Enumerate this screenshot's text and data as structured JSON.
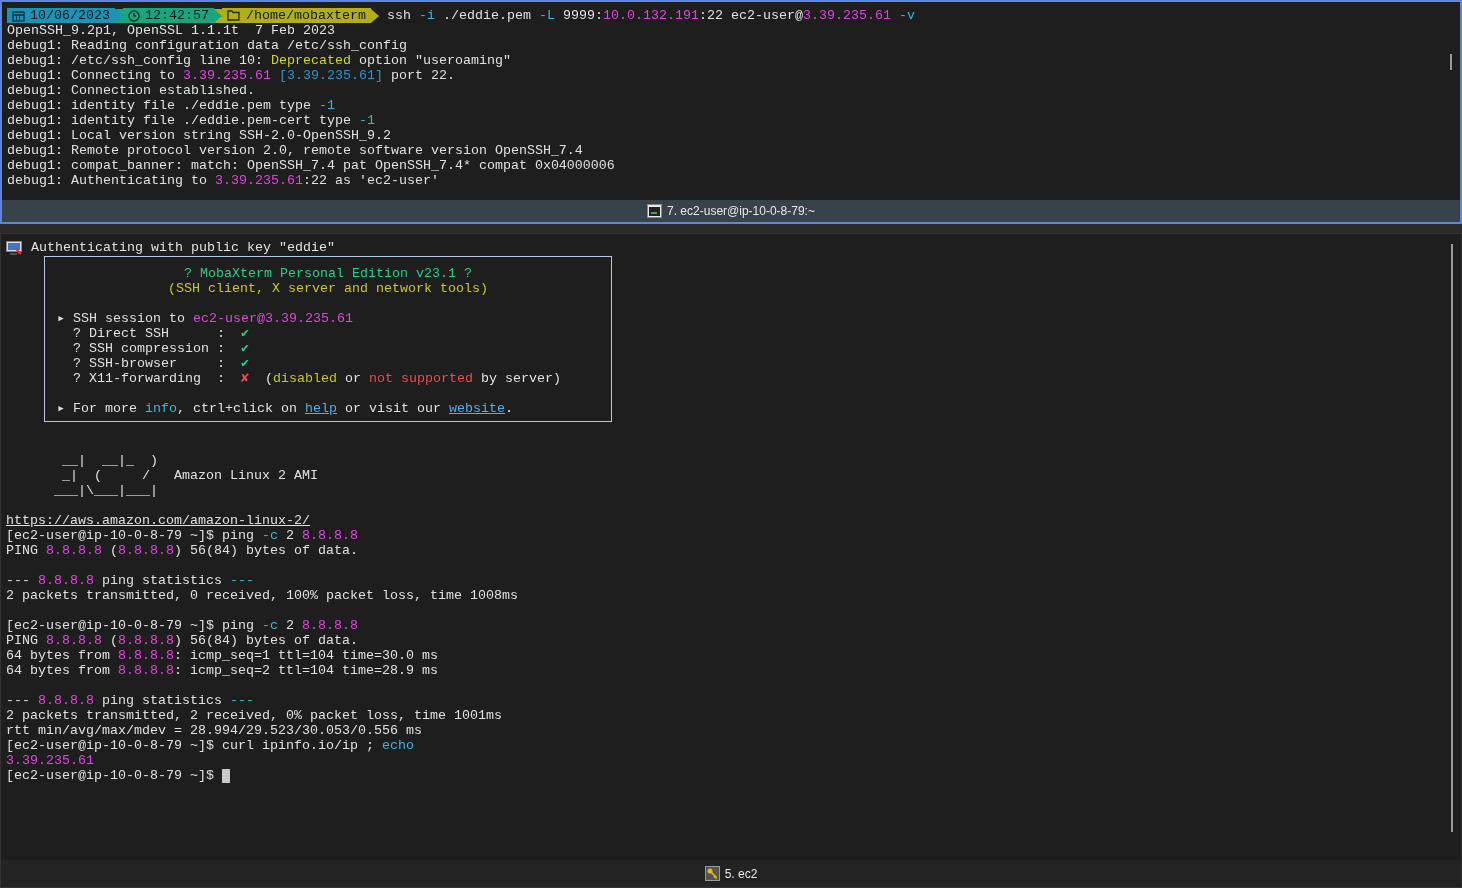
{
  "panes": [
    {
      "active": true,
      "title": "7. ec2-user@ip-10-0-8-79:~",
      "kind": "shell",
      "prompt": [
        {
          "kind": "date",
          "text": "10/06/2023",
          "color": "#1c93b4"
        },
        {
          "kind": "time",
          "text": "12:42:57",
          "color": "#17a77e"
        },
        {
          "kind": "path",
          "text": "/home/mobaxterm",
          "color": "#b3ad16"
        }
      ],
      "command": [
        {
          "text": "ssh "
        },
        {
          "text": "-i",
          "color": "#3ab6d6"
        },
        {
          "text": " ./eddie.pem "
        },
        {
          "text": "-L",
          "color": "#3ab6d6"
        },
        {
          "text": " 9999:"
        },
        {
          "text": "10.0.132.191",
          "color": "#e044e0"
        },
        {
          "text": ":22 ec2-user@"
        },
        {
          "text": "3.39.235.61",
          "color": "#e044e0"
        },
        {
          "text": " -v",
          "color": "#3ab6d6"
        }
      ],
      "lines": [
        {
          "kind": "text",
          "segments": [
            {
              "text": "OpenSSH_9.2p1, OpenSSL 1.1.1t  7 Feb 2023"
            }
          ]
        },
        {
          "kind": "text",
          "segments": [
            {
              "text": "debug1: Reading configuration data /etc/ssh_config"
            }
          ]
        },
        {
          "kind": "text",
          "segments": [
            {
              "text": "debug1: /etc/ssh_config line 10: "
            },
            {
              "text": "Deprecated",
              "color": "#d6d61e"
            },
            {
              "text": " option \"useroaming\""
            }
          ]
        },
        {
          "kind": "text",
          "segments": [
            {
              "text": "debug1: Connecting to "
            },
            {
              "text": "3.39.235.61",
              "color": "#e044e0"
            },
            {
              "text": " [3.39.235.61]",
              "color": "#2a93c8"
            },
            {
              "text": " port 22."
            }
          ]
        },
        {
          "kind": "text",
          "segments": [
            {
              "text": "debug1: Connection established."
            }
          ]
        },
        {
          "kind": "text",
          "segments": [
            {
              "text": "debug1: identity file ./eddie.pem type "
            },
            {
              "text": "-1",
              "color": "#3ab6d6"
            }
          ]
        },
        {
          "kind": "text",
          "segments": [
            {
              "text": "debug1: identity file ./eddie.pem-cert type "
            },
            {
              "text": "-1",
              "color": "#3ab6d6"
            }
          ]
        },
        {
          "kind": "text",
          "segments": [
            {
              "text": "debug1: Local version string SSH-2.0-OpenSSH_9.2"
            }
          ]
        },
        {
          "kind": "text",
          "segments": [
            {
              "text": "debug1: Remote protocol version 2.0, remote software version OpenSSH_7.4"
            }
          ]
        },
        {
          "kind": "text",
          "segments": [
            {
              "text": "debug1: compat_banner: match: OpenSSH_7.4 pat OpenSSH_7.4* compat 0x04000006"
            }
          ]
        },
        {
          "kind": "text",
          "segments": [
            {
              "text": "debug1: Authenticating to "
            },
            {
              "text": "3.39.235.61",
              "color": "#e044e0"
            },
            {
              "text": ":22 as 'ec2-user'"
            }
          ]
        }
      ]
    },
    {
      "active": false,
      "title": "5. ec2",
      "kind": "ssh",
      "lines": [
        {
          "kind": "notice",
          "segments": [
            {
              "text": "Authenticating with public key \"eddie\""
            }
          ]
        },
        {
          "kind": "box",
          "lines": [
            {
              "kind": "heading",
              "segments": [
                {
                  "text": "? MobaXterm Personal Edition v23.1 ?",
                  "color": "#1fd28a"
                }
              ]
            },
            {
              "kind": "heading",
              "segments": [
                {
                  "text": "(SSH client, X server and network tools)",
                  "color": "#c9c922"
                }
              ]
            },
            {
              "kind": "blank"
            },
            {
              "segments": [
                {
                  "text": "▸ SSH session to "
                },
                {
                  "text": "ec2-user@3.39.235.61",
                  "color": "#e044e0"
                }
              ]
            },
            {
              "segments": [
                {
                  "text": "  ? Direct SSH      :  "
                },
                {
                  "text": "✔",
                  "color": "#1fd28a"
                }
              ]
            },
            {
              "segments": [
                {
                  "text": "  ? SSH compression :  "
                },
                {
                  "text": "✔",
                  "color": "#1fd28a"
                }
              ]
            },
            {
              "segments": [
                {
                  "text": "  ? SSH-browser     :  "
                },
                {
                  "text": "✔",
                  "color": "#1fd28a"
                }
              ]
            },
            {
              "segments": [
                {
                  "text": "  ? X11-forwarding  :  "
                },
                {
                  "text": "✘",
                  "color": "#f04a4a"
                },
                {
                  "text": "  ("
                },
                {
                  "text": "disabled",
                  "color": "#c9c922"
                },
                {
                  "text": " or "
                },
                {
                  "text": "not supported",
                  "color": "#f04a4a"
                },
                {
                  "text": " by server)"
                }
              ]
            },
            {
              "kind": "blank"
            },
            {
              "segments": [
                {
                  "text": "▸ For more "
                },
                {
                  "text": "info",
                  "color": "#3ab6d6"
                },
                {
                  "text": ", ctrl+click on "
                },
                {
                  "kind": "link",
                  "text": "help",
                  "color": "#4ab0f0"
                },
                {
                  "text": " or visit our "
                },
                {
                  "kind": "link",
                  "text": "website",
                  "color": "#4ab0f0"
                },
                {
                  "text": "."
                }
              ]
            }
          ]
        },
        {
          "kind": "blank"
        },
        {
          "kind": "blank"
        },
        {
          "kind": "text",
          "segments": [
            {
              "text": "       __|  __|_  )"
            }
          ]
        },
        {
          "kind": "text",
          "segments": [
            {
              "text": "       _|  (     /   Amazon Linux 2 AMI"
            }
          ]
        },
        {
          "kind": "text",
          "segments": [
            {
              "text": "      ___|\\___|___|"
            }
          ]
        },
        {
          "kind": "blank"
        },
        {
          "kind": "text",
          "segments": [
            {
              "kind": "link",
              "text": "https://aws.amazon.com/amazon-linux-2/"
            }
          ]
        },
        {
          "kind": "text",
          "segments": [
            {
              "text": "[ec2-user@ip-10-0-8-79 ~]$ ping "
            },
            {
              "text": "-c",
              "color": "#3ab6d6"
            },
            {
              "text": " 2 "
            },
            {
              "text": "8.8.8.8",
              "color": "#e044e0"
            }
          ]
        },
        {
          "kind": "text",
          "segments": [
            {
              "text": "PING "
            },
            {
              "text": "8.8.8.8",
              "color": "#e044e0"
            },
            {
              "text": " ("
            },
            {
              "text": "8.8.8.8",
              "color": "#e044e0"
            },
            {
              "text": ") 56(84) bytes of data."
            }
          ]
        },
        {
          "kind": "blank"
        },
        {
          "kind": "text",
          "segments": [
            {
              "text": "--- "
            },
            {
              "text": "8.8.8.8",
              "color": "#e044e0"
            },
            {
              "text": " ping statistics "
            },
            {
              "text": "---",
              "color": "#3ab6d6"
            }
          ]
        },
        {
          "kind": "text",
          "segments": [
            {
              "text": "2 packets transmitted, 0 received, 100% packet loss, time 1008ms"
            }
          ]
        },
        {
          "kind": "blank"
        },
        {
          "kind": "text",
          "segments": [
            {
              "text": "[ec2-user@ip-10-0-8-79 ~]$ ping "
            },
            {
              "text": "-c",
              "color": "#3ab6d6"
            },
            {
              "text": " 2 "
            },
            {
              "text": "8.8.8.8",
              "color": "#e044e0"
            }
          ]
        },
        {
          "kind": "text",
          "segments": [
            {
              "text": "PING "
            },
            {
              "text": "8.8.8.8",
              "color": "#e044e0"
            },
            {
              "text": " ("
            },
            {
              "text": "8.8.8.8",
              "color": "#e044e0"
            },
            {
              "text": ") 56(84) bytes of data."
            }
          ]
        },
        {
          "kind": "text",
          "segments": [
            {
              "text": "64 bytes from "
            },
            {
              "text": "8.8.8.8",
              "color": "#e044e0"
            },
            {
              "text": ": icmp_seq=1 ttl=104 time=30.0 ms"
            }
          ]
        },
        {
          "kind": "text",
          "segments": [
            {
              "text": "64 bytes from "
            },
            {
              "text": "8.8.8.8",
              "color": "#e044e0"
            },
            {
              "text": ": icmp_seq=2 ttl=104 time=28.9 ms"
            }
          ]
        },
        {
          "kind": "blank"
        },
        {
          "kind": "text",
          "segments": [
            {
              "text": "--- "
            },
            {
              "text": "8.8.8.8",
              "color": "#e044e0"
            },
            {
              "text": " ping statistics "
            },
            {
              "text": "---",
              "color": "#3ab6d6"
            }
          ]
        },
        {
          "kind": "text",
          "segments": [
            {
              "text": "2 packets transmitted, 2 received, 0% packet loss, time 1001ms"
            }
          ]
        },
        {
          "kind": "text",
          "segments": [
            {
              "text": "rtt min/avg/max/mdev = 28.994/29.523/30.053/0.556 ms"
            }
          ]
        },
        {
          "kind": "text",
          "segments": [
            {
              "text": "[ec2-user@ip-10-0-8-79 ~]$ curl ipinfo.io/ip ; "
            },
            {
              "text": "echo",
              "color": "#3ab6d6"
            }
          ]
        },
        {
          "kind": "text",
          "segments": [
            {
              "text": "3.39.235.61",
              "color": "#e044e0"
            }
          ]
        },
        {
          "kind": "cursor",
          "segments": [
            {
              "text": "[ec2-user@ip-10-0-8-79 ~]$ "
            }
          ]
        }
      ]
    }
  ]
}
